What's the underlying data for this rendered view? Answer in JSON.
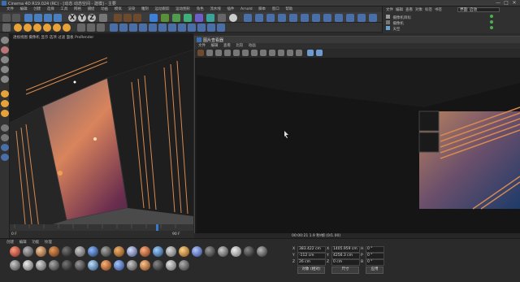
{
  "titlebar": {
    "title": "Cinema 4D R19.024 (RC) - [动态 动态空间 - 建模] - 主要",
    "min": "—",
    "max": "□",
    "close": "✕"
  },
  "menubar": {
    "items": [
      "文件",
      "编辑",
      "创建",
      "选择",
      "工具",
      "网格",
      "捕捉",
      "动画",
      "模拟",
      "渲染",
      "雕刻",
      "运动跟踪",
      "运动图形",
      "角色",
      "流水线",
      "插件",
      "Arnold",
      "脚本",
      "窗口",
      "帮助"
    ]
  },
  "rightpanel": {
    "tabs": [
      "文件",
      "编辑",
      "查看",
      "对象",
      "标签",
      "书签"
    ],
    "layout_label": "界面: 启动",
    "rows": [
      {
        "name": "摄像机目标"
      },
      {
        "name": "摄像机"
      },
      {
        "name": "天空"
      }
    ]
  },
  "viewport": {
    "label": "透视视图  摄像机  显示  选项  过滤  面板  ProRender"
  },
  "render_panel": {
    "title": "图片查看器",
    "menu": [
      "文件",
      "编辑",
      "查看",
      "比较",
      "动画"
    ],
    "status": "00:00:21  1.9 秒/帧  (0/1.00)"
  },
  "timeline": {
    "ticks": [
      "0",
      "10",
      "20",
      "30",
      "40",
      "50",
      "60",
      "70",
      "80",
      "90",
      "100",
      "110",
      "120"
    ],
    "start": "0 F",
    "end": "90 F",
    "current": "0 F"
  },
  "materials": {
    "menu": [
      "创建",
      "编辑",
      "功能",
      "纹理"
    ],
    "count": 34
  },
  "attributes": {
    "rows": [
      {
        "label": "X",
        "value": "383.422 cm"
      },
      {
        "label": "Y",
        "value": "-112 cm"
      },
      {
        "label": "Z",
        "value": "26 cm"
      }
    ],
    "size_rows": [
      {
        "label": "X",
        "value": "1405.959 cm"
      },
      {
        "label": "Y",
        "value": "4256.3 cm"
      },
      {
        "label": "Z",
        "value": "0 cm"
      }
    ],
    "rot_rows": [
      {
        "label": "H",
        "value": "0 °"
      },
      {
        "label": "P",
        "value": "0 °"
      },
      {
        "label": "B",
        "value": "0 °"
      }
    ],
    "mode_left": "对象 (相对)",
    "mode_mid": "尺寸",
    "apply": "应用"
  },
  "colors": {
    "accent": "#e8a23a",
    "bg": "#2b2b2b",
    "panel": "#1a1a1a"
  }
}
